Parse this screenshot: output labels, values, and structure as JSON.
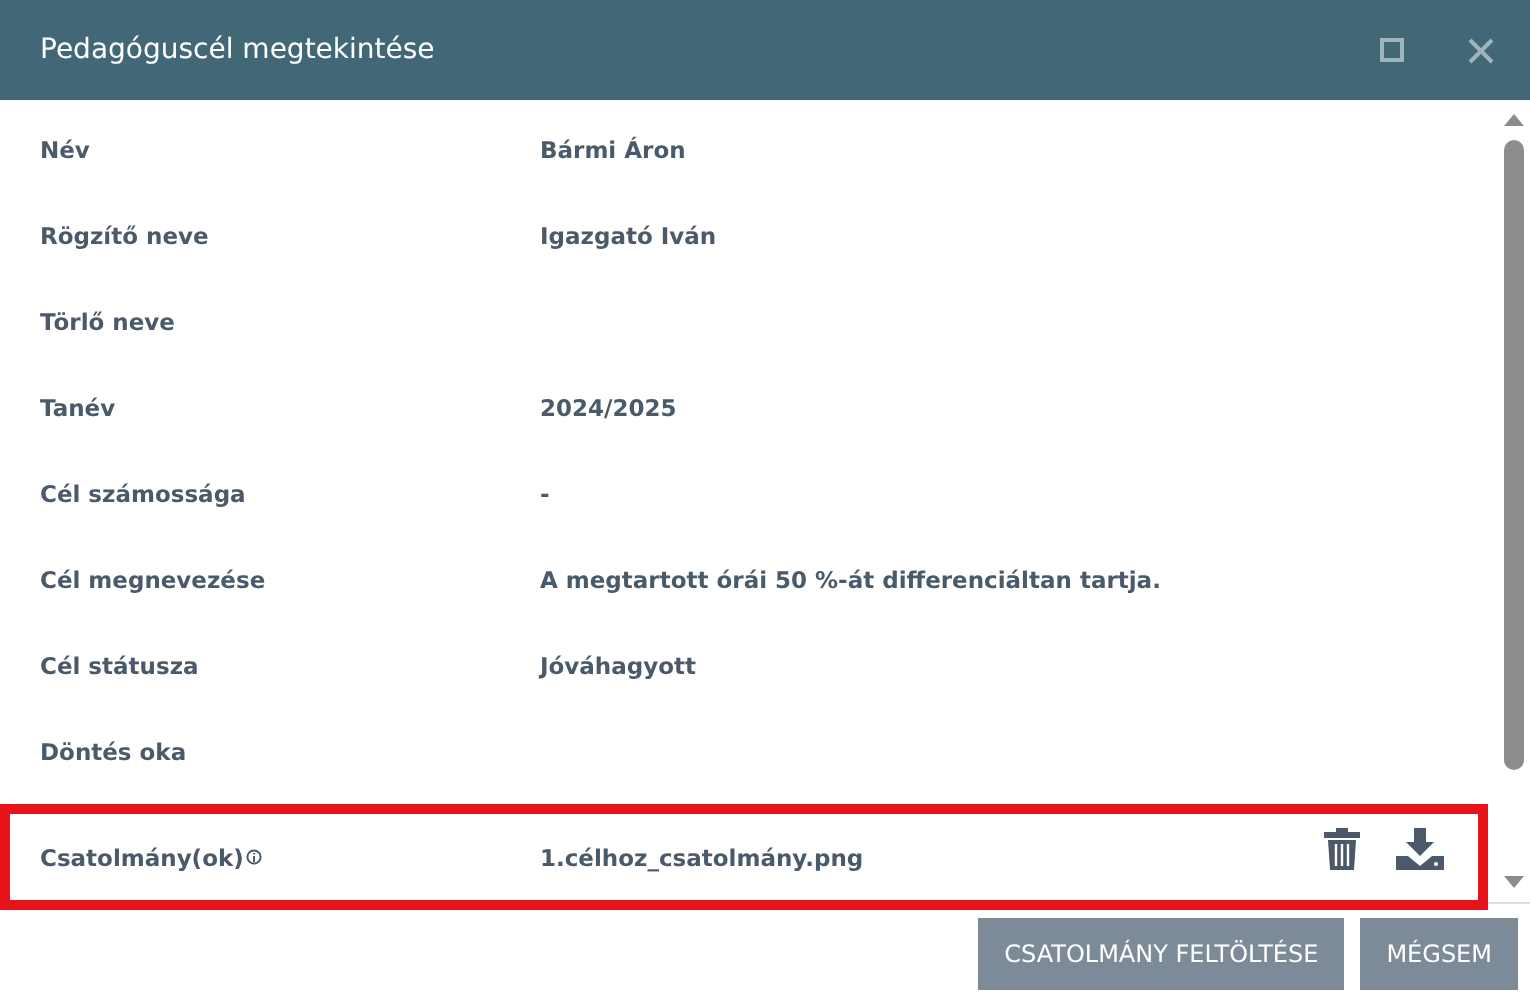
{
  "window": {
    "title": "Pedagóguscél megtekintése"
  },
  "fields": [
    {
      "label": "Név",
      "value": "Bármi Áron"
    },
    {
      "label": "Rögzítő neve",
      "value": "Igazgató Iván"
    },
    {
      "label": "Törlő neve"
    },
    {
      "label": "Tanév",
      "value": "2024/2025"
    },
    {
      "label": "Cél számossága",
      "value": "-"
    },
    {
      "label": "Cél megnevezése",
      "value": "A megtartott órái 50 %-át differenciáltan tartja."
    },
    {
      "label": "Cél státusza",
      "value": "Jóváhagyott"
    },
    {
      "label": "Döntés oka"
    },
    {
      "label": "Csatolmány(ok)",
      "kind": "attachment",
      "value": "1.célhoz_csatolmány.png",
      "highlighted": true
    }
  ],
  "buttons": [
    "CSATOLMÁNY FELTÖLTÉSE",
    "MÉGSEM"
  ]
}
